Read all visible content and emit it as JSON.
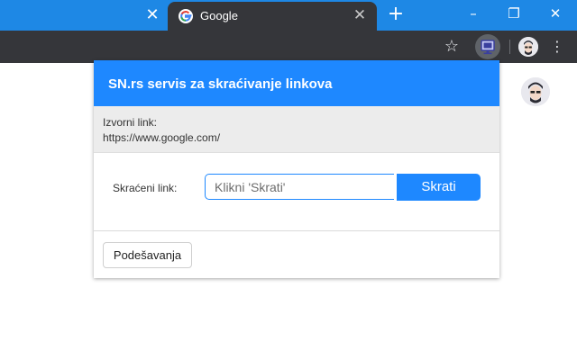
{
  "browser": {
    "tab_title": "Google",
    "tab_close_glyph": "✕",
    "prev_tab_close_glyph": "✕",
    "new_tab_glyph": "+",
    "window_controls": {
      "minimize": "–",
      "maximize": "❐",
      "close": "✕"
    },
    "toolbar": {
      "bookmark_glyph": "☆",
      "menu_glyph": "⋮"
    },
    "colors": {
      "tabstrip": "#1e88e5",
      "toolbar": "#35363a"
    }
  },
  "popup": {
    "title": "SN.rs servis za skraćivanje linkova",
    "source_label": "Izvorni link:",
    "source_url": "https://www.google.com/",
    "short_label": "Skraćeni link:",
    "short_input_placeholder": "Klikni 'Skrati'",
    "short_input_value": "",
    "shorten_button": "Skrati",
    "settings_button": "Podešavanja",
    "colors": {
      "accent": "#1e88ff"
    }
  }
}
